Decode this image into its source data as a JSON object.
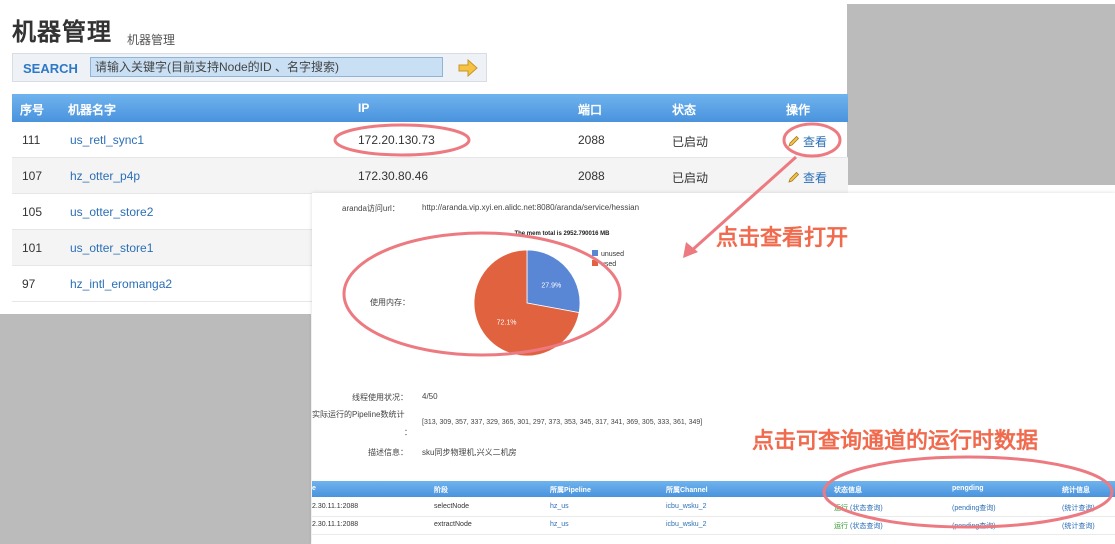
{
  "header": {
    "title": "机器管理",
    "subtitle": "机器管理"
  },
  "search": {
    "label": "SEARCH",
    "placeholder": "请输入关键字(目前支持Node的ID 、名字搜索)"
  },
  "table": {
    "headers": [
      "序号",
      "机器名字",
      "IP",
      "端口",
      "状态",
      "操作"
    ],
    "rows": [
      {
        "id": "111",
        "name": "us_retl_sync1",
        "ip": "172.20.130.73",
        "port": "2088",
        "status": "已启动",
        "action": "查看"
      },
      {
        "id": "107",
        "name": "hz_otter_p4p",
        "ip": "172.30.80.46",
        "port": "2088",
        "status": "已启动",
        "action": "查看"
      },
      {
        "id": "105",
        "name": "us_otter_store2"
      },
      {
        "id": "101",
        "name": "us_otter_store1"
      },
      {
        "id": "97",
        "name": "hz_intl_eromanga2"
      }
    ]
  },
  "detail": {
    "aranda_label": "aranda访问url：",
    "aranda_value": "http://aranda.vip.xyi.en.alidc.net:8080/aranda/service/hessian",
    "mem_label": "使用内存：",
    "thread_label": "线程使用状况：",
    "thread_value": "4/50",
    "pipeline_label": "实际运行的Pipeline数统计",
    "pipeline_colon": "：",
    "pipeline_value": "[313, 309, 357, 337, 329, 365, 301, 297, 373, 353, 345, 317, 341, 369, 305, 333, 361, 349]",
    "desc_label": "描述信息：",
    "desc_value": "sku同步物理机,兴义二机房"
  },
  "chart_data": {
    "type": "pie",
    "title": "The mem total is 2952.790016 MB",
    "categories": [
      "unused",
      "used"
    ],
    "values": [
      27.9,
      72.1
    ],
    "labels": [
      "27.9%",
      "72.1%"
    ],
    "colors": [
      "#5a86d6",
      "#e0623f"
    ],
    "legend": "right"
  },
  "pipelines": {
    "headers": [
      "e",
      "阶段",
      "所属Pipeline",
      "所属Channel",
      "状态信息",
      "pengding",
      "统计信息"
    ],
    "rows": [
      {
        "ip": "2.30.11.1:2088",
        "stage": "selectNode",
        "pipeline": "hz_us",
        "channel": "icbu_wsku_2",
        "status": "运行",
        "status_link": "(状态查询)",
        "pending": "(pending查询)",
        "stats": "(统计查询)"
      },
      {
        "ip": "2.30.11.1:2088",
        "stage": "extractNode",
        "pipeline": "hz_us",
        "channel": "icbu_wsku_2",
        "status": "运行",
        "status_link": "(状态查询)",
        "pending": "(pending查询)",
        "stats": "(统计查询)"
      }
    ]
  },
  "annotations": {
    "open_hint": "点击查看打开",
    "runtime_hint": "点击可查询通道的运行时数据"
  },
  "colors": {
    "accent": "#4a93dd",
    "annotation": "#f06a4e",
    "link": "#2b6fb6"
  }
}
